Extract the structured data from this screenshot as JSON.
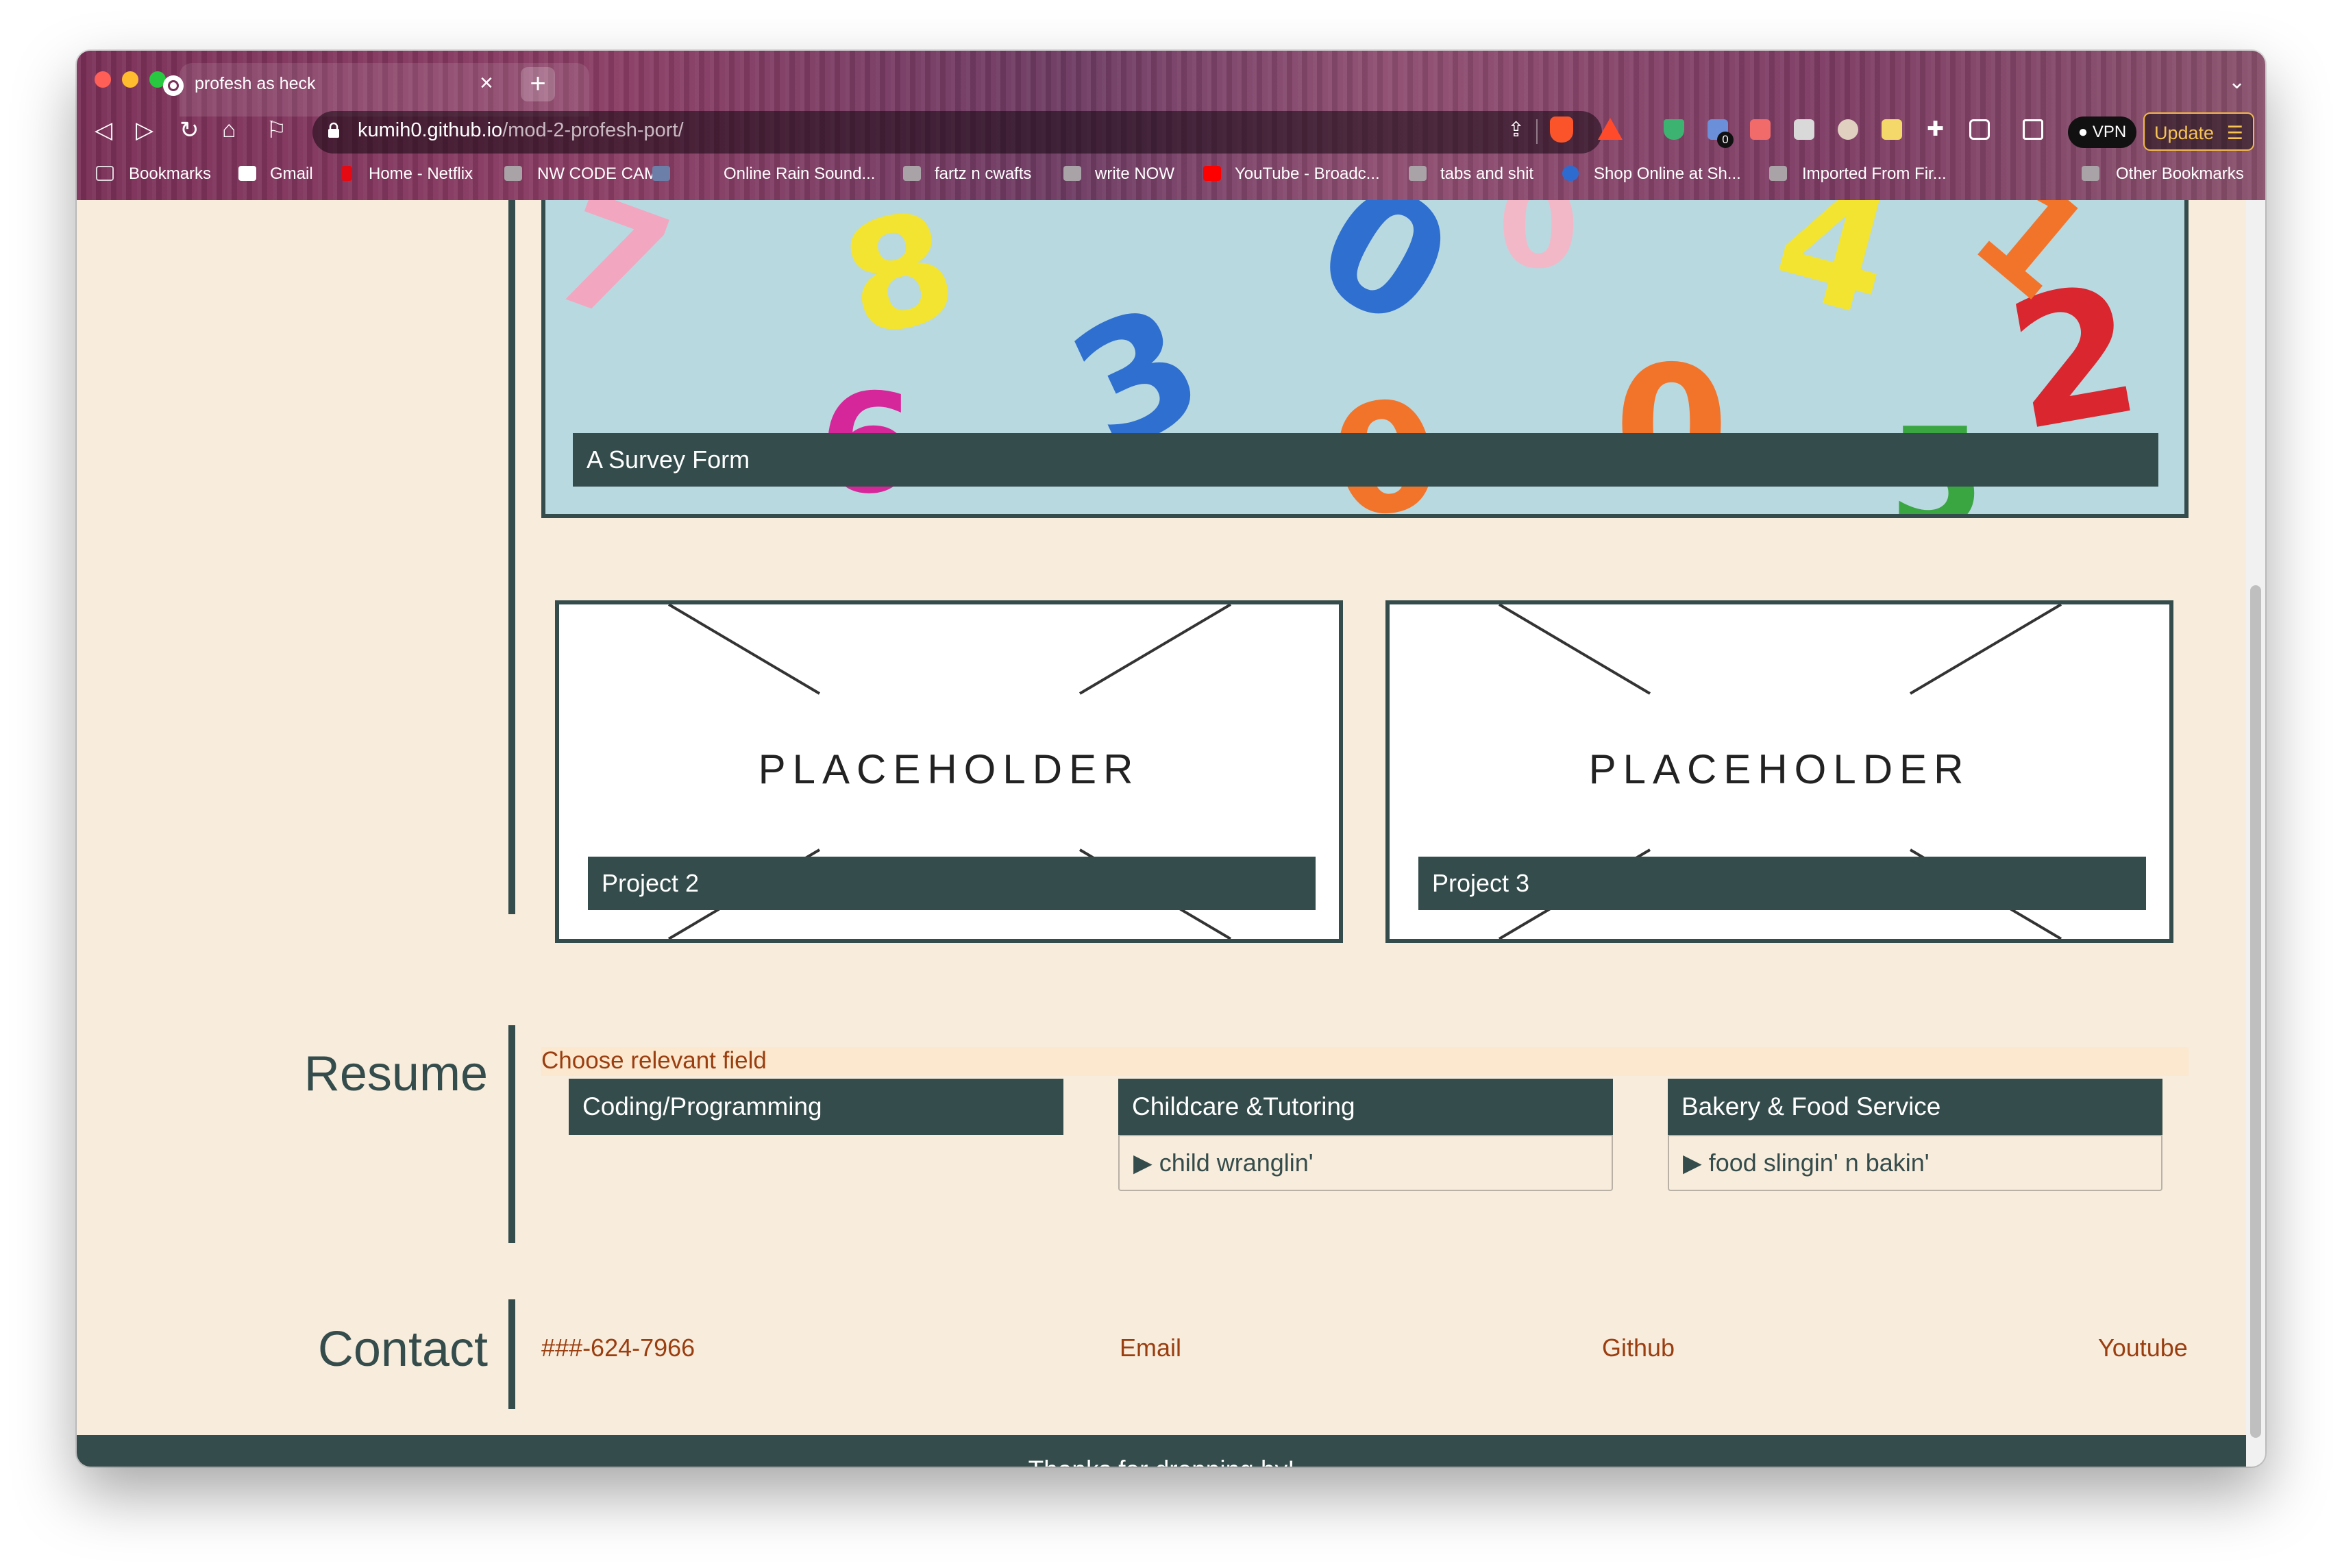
{
  "browser": {
    "tab_title": "profesh as heck",
    "tab_close": "×",
    "new_tab": "+",
    "url_host": "kumih0.github.io",
    "url_path": "/mod-2-profesh-port/",
    "vpn_label": "● VPN",
    "update_label": "Update",
    "ext_badge": "0"
  },
  "bookmarks": [
    {
      "label": "Bookmarks",
      "icon": "bookmarks-icon"
    },
    {
      "label": "Gmail",
      "icon": "gmail-icon"
    },
    {
      "label": "Home - Netflix",
      "icon": "netflix-icon"
    },
    {
      "label": "NW CODE CAMP",
      "icon": "folder-icon"
    },
    {
      "label": "Online Rain Sound...",
      "icon": "folder-icon"
    },
    {
      "label": "fartz n cwafts",
      "icon": "folder-icon"
    },
    {
      "label": "write NOW",
      "icon": "folder-icon"
    },
    {
      "label": "YouTube - Broadc...",
      "icon": "youtube-icon"
    },
    {
      "label": "tabs and shit",
      "icon": "folder-icon"
    },
    {
      "label": "Shop Online at Sh...",
      "icon": "shop-icon"
    },
    {
      "label": "Imported From Fir...",
      "icon": "folder-icon"
    },
    {
      "label": "Other Bookmarks",
      "icon": "folder-icon"
    }
  ],
  "projects": {
    "featured_caption": "A Survey Form",
    "cards": [
      {
        "placeholder": "PLACEHOLDER",
        "caption": "Project 2"
      },
      {
        "placeholder": "PLACEHOLDER",
        "caption": "Project 3"
      }
    ]
  },
  "resume": {
    "title": "Resume",
    "prompt": "Choose relevant field",
    "fields": [
      {
        "name": "Coding/Programming",
        "detail": ""
      },
      {
        "name": "Childcare &Tutoring",
        "detail": "▶ child wranglin'"
      },
      {
        "name": "Bakery & Food Service",
        "detail": "▶ food slingin' n bakin'"
      }
    ]
  },
  "contact": {
    "title": "Contact",
    "phone": "###-624-7966",
    "email": "Email",
    "github": "Github",
    "youtube": "Youtube"
  },
  "footer": {
    "text": "Thanks for dropping by!"
  },
  "colors": {
    "accent": "#344c4b",
    "background": "#f8ecdc",
    "link": "#9a3e10"
  }
}
